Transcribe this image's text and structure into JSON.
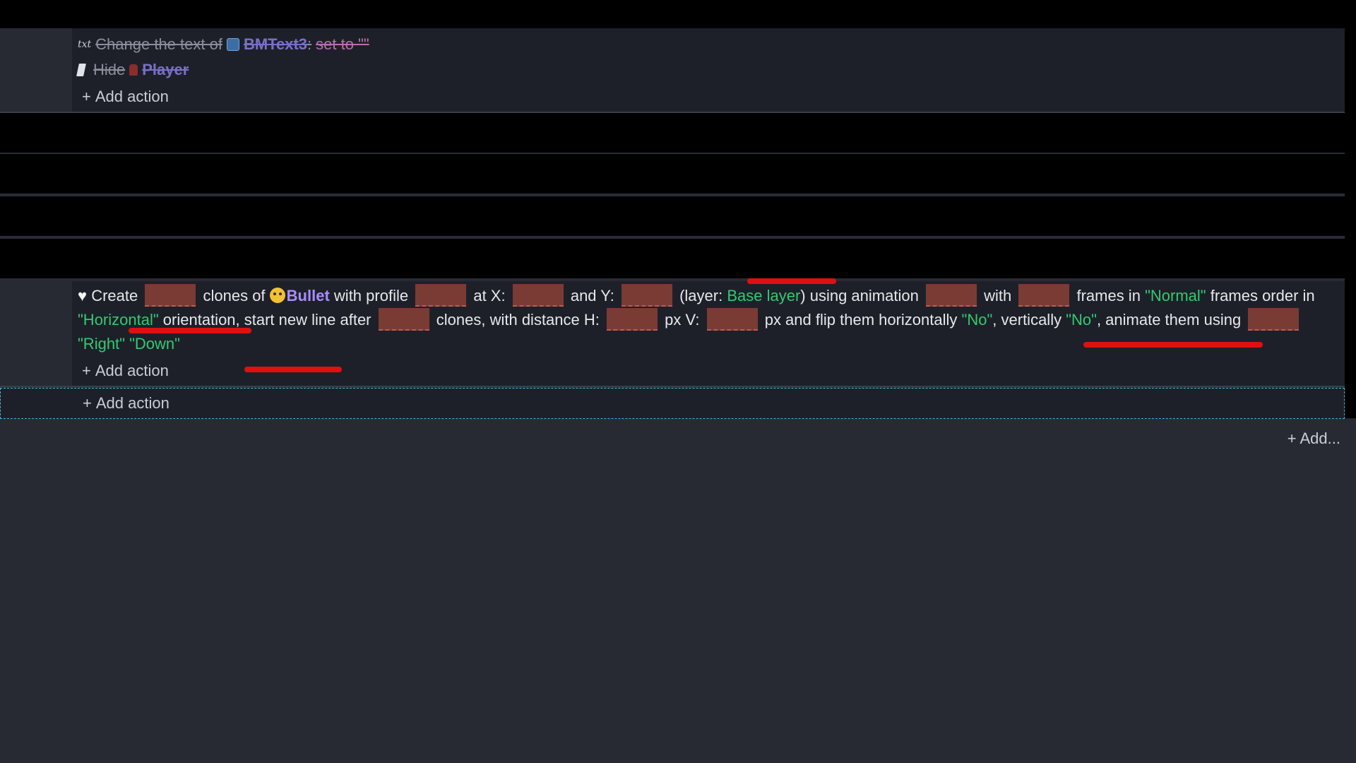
{
  "block1": {
    "line1": {
      "text": "Change the text of",
      "object": "BMText3",
      "separator": ":",
      "param": "set to \"\""
    },
    "line2": {
      "text": "Hide",
      "object": "Player"
    },
    "add_action": "Add action"
  },
  "create_block": {
    "words": {
      "create": "Create",
      "clones_of": "clones of",
      "object": "Bullet",
      "with_profile": "with profile",
      "at_x": "at X:",
      "and_y": "and Y:",
      "layer_open": "(layer:",
      "layer_value": "Base layer",
      "layer_close": ") using animation",
      "with": "with",
      "frames_in": "frames in",
      "frames_mode": "\"Normal\"",
      "frames_order_in": "frames order in",
      "orientation_value": "\"Horizontal\"",
      "orientation_after": "orientation, start new line after",
      "clones_distance": "clones, with distance H:",
      "px_v": "px V:",
      "px_flip": "px and flip them horizontally",
      "flip_h": "\"No\"",
      "vertically": ", vertically",
      "flip_v": "\"No\"",
      "animate": ", animate them using",
      "dir1": "\"Right\"",
      "dir2": "\"Down\""
    },
    "add_action": "Add action"
  },
  "root_add_action": "Add action",
  "add_generic": "+ Add..."
}
